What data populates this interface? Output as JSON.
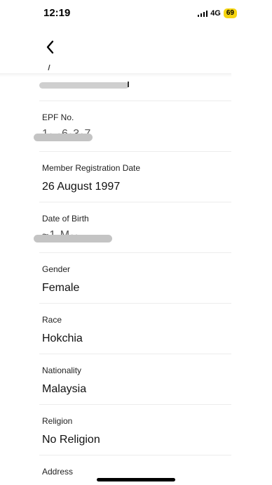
{
  "status_bar": {
    "time": "12:19",
    "network": "4G",
    "battery": "69"
  },
  "fields": [
    {
      "label": "EPF No.",
      "value": "",
      "masked_peek": "1·.·6·3·7"
    },
    {
      "label": "Member Registration Date",
      "value": "26 August 1997"
    },
    {
      "label": "Date of Birth",
      "value": "",
      "masked_peek": "~1 M··"
    },
    {
      "label": "Gender",
      "value": "Female"
    },
    {
      "label": "Race",
      "value": "Hokchia"
    },
    {
      "label": "Nationality",
      "value": "Malaysia"
    },
    {
      "label": "Religion",
      "value": "No Religion"
    },
    {
      "label": "Address",
      "value": ""
    }
  ],
  "colors": {
    "battery": "#f5d410",
    "redaction": "#c4c4c4",
    "divider": "#ececec"
  },
  "icons": {
    "back": "chevron-left-icon",
    "signal": "signal-icon"
  }
}
